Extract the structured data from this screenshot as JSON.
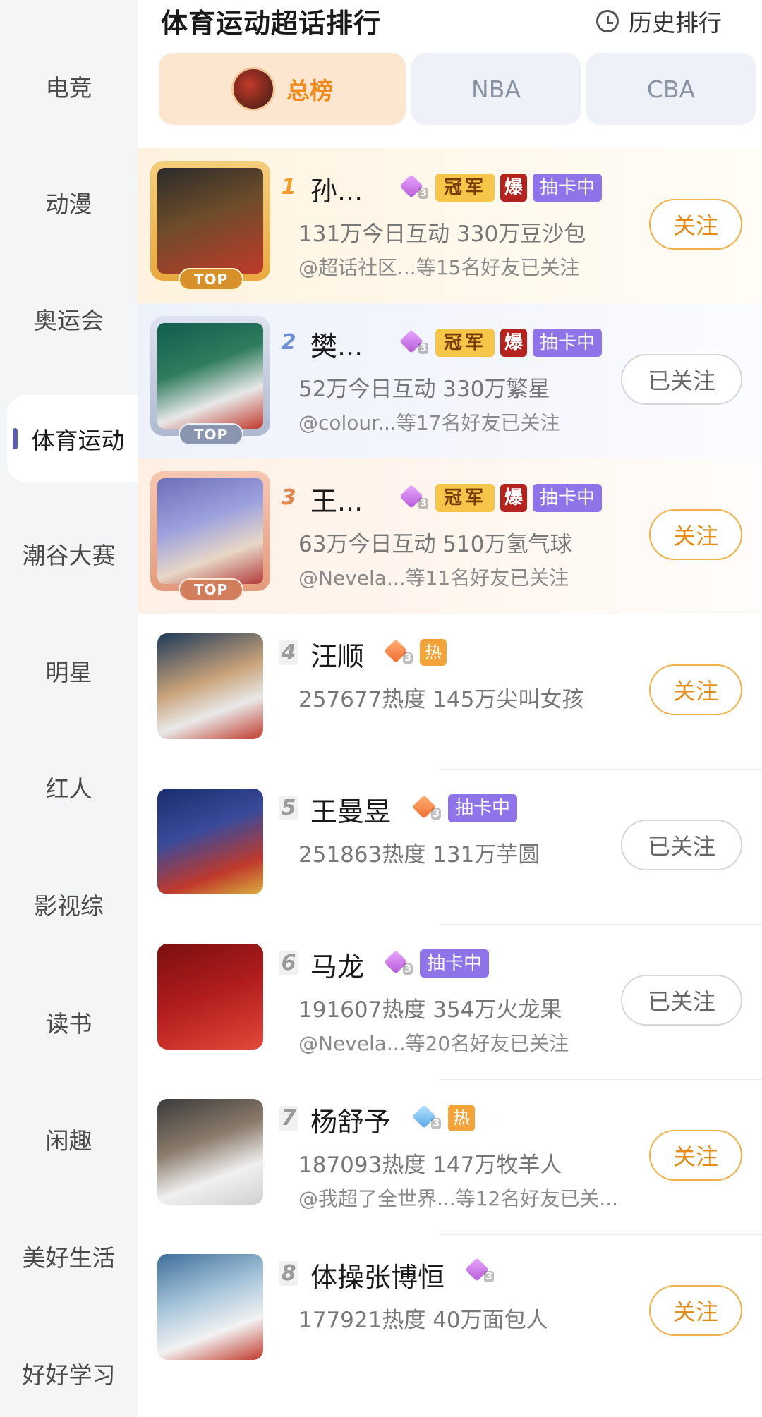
{
  "header": {
    "title": "体育运动超话排行",
    "history_label": "历史排行"
  },
  "tabs": [
    {
      "label": "总榜",
      "active": true
    },
    {
      "label": "NBA",
      "active": false
    },
    {
      "label": "CBA",
      "active": false
    }
  ],
  "sidebar": {
    "items": [
      {
        "label": "电竞",
        "active": false
      },
      {
        "label": "动漫",
        "active": false
      },
      {
        "label": "奥运会",
        "active": false
      },
      {
        "label": "体育运动",
        "active": true
      },
      {
        "label": "潮谷大赛",
        "active": false
      },
      {
        "label": "明星",
        "active": false
      },
      {
        "label": "红人",
        "active": false
      },
      {
        "label": "影视综",
        "active": false
      },
      {
        "label": "读书",
        "active": false
      },
      {
        "label": "闲趣",
        "active": false
      },
      {
        "label": "美好生活",
        "active": false
      },
      {
        "label": "好好学习",
        "active": false
      }
    ]
  },
  "badge_labels": {
    "champion": "冠军",
    "boom": "爆",
    "draw": "抽卡中",
    "hot": "热",
    "top": "TOP"
  },
  "colors": {
    "accent": "#f08a1c",
    "follow_border": "#f0b04a",
    "draw_badge": "#8e74e8",
    "boom_badge": "#b5231f",
    "champion_badge": "#f6c64a"
  },
  "rankings": [
    {
      "rank": "1",
      "name": "孙...",
      "stats": "131万今日互动 330万豆沙包",
      "friends": "@超话社区...等15名好友已关注",
      "button": "关注",
      "followed": false
    },
    {
      "rank": "2",
      "name": "樊...",
      "stats": "52万今日互动 330万繁星",
      "friends": "@colour...等17名好友已关注",
      "button": "已关注",
      "followed": true
    },
    {
      "rank": "3",
      "name": "王...",
      "stats": "63万今日互动 510万氢气球",
      "friends": "@Nevela...等11名好友已关注",
      "button": "关注",
      "followed": false
    },
    {
      "rank": "4",
      "name": "汪顺",
      "stats": "257677热度 145万尖叫女孩",
      "friends": "",
      "button": "关注",
      "followed": false
    },
    {
      "rank": "5",
      "name": "王曼昱",
      "stats": "251863热度 131万芋圆",
      "friends": "",
      "button": "已关注",
      "followed": true
    },
    {
      "rank": "6",
      "name": "马龙",
      "stats": "191607热度 354万火龙果",
      "friends": "@Nevela...等20名好友已关注",
      "button": "已关注",
      "followed": true
    },
    {
      "rank": "7",
      "name": "杨舒予",
      "stats": "187093热度 147万牧羊人",
      "friends": "@我超了全世界...等12名好友已关...",
      "button": "关注",
      "followed": false
    },
    {
      "rank": "8",
      "name": "体操张博恒",
      "stats": "177921热度 40万面包人",
      "friends": "",
      "button": "关注",
      "followed": false
    }
  ]
}
